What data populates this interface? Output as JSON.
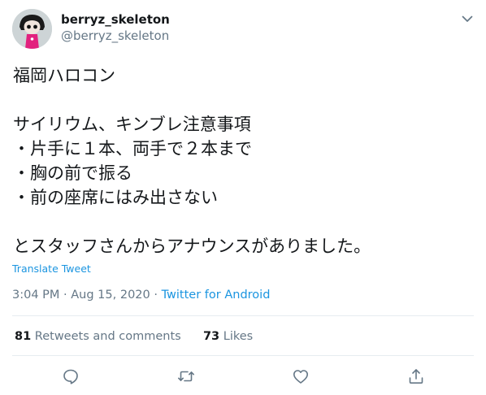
{
  "tweet": {
    "display_name": "berryz_skeleton",
    "handle": "@berryz_skeleton",
    "text": "福岡ハロコン\n\nサイリウム、キンブレ注意事項\n・片手に１本、両手で２本まで\n・胸の前で振る\n・前の座席にはみ出さない\n\nとスタッフさんからアナウンスがありました。",
    "translate_label": "Translate Tweet",
    "timestamp": "3:04 PM · Aug 15, 2020 · ",
    "source": "Twitter for Android"
  },
  "stats": {
    "retweets_count": "81",
    "retweets_label": "Retweets and comments",
    "likes_count": "73",
    "likes_label": "Likes"
  },
  "icons": {
    "caret": "chevron-down-icon",
    "reply": "reply-icon",
    "retweet": "retweet-icon",
    "like": "heart-icon",
    "share": "share-icon"
  },
  "colors": {
    "accent": "#1b95e0",
    "secondary_text": "#657786",
    "divider": "#e6ecf0"
  }
}
